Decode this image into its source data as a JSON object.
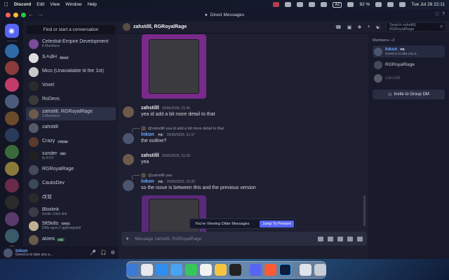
{
  "menubar": {
    "app": "Discord",
    "menus": [
      "Edit",
      "View",
      "Window",
      "Help"
    ],
    "input_source": "AZ",
    "battery": "92 %",
    "datetime": "Tue Jul 28  22:11"
  },
  "window": {
    "title": "Direct Messages"
  },
  "dm_list": {
    "search_label": "Find or start a conversation",
    "items": [
      {
        "name": "Celestial-Empire Development",
        "sub": "8 Members",
        "color": "#7a4a9c"
      },
      {
        "name": "ՏᗅᏰᎻ",
        "tag": "blend",
        "sub": "",
        "color": "#dddddd"
      },
      {
        "name": "Mico (Unavailable til the 1st)",
        "sub": "",
        "color": "#c9c9c9"
      },
      {
        "name": "Voxel",
        "sub": "",
        "color": "#2b2b2b"
      },
      {
        "name": "RoDevs",
        "sub": "",
        "color": "#3a3a3a"
      },
      {
        "name": "zahstilll, RGRoyalRage",
        "sub": "3 Members",
        "color": "#6d5a4a"
      },
      {
        "name": "zahstilll",
        "sub": "",
        "color": "#555a66"
      },
      {
        "name": "Crazy",
        "tag": "FRDM",
        "sub": "",
        "color": "#5a3a2c"
      },
      {
        "name": "sunder",
        "tag": "MD",
        "sub": "ily EVO",
        "color": "#202020"
      },
      {
        "name": "RGRoyalRage",
        "sub": "",
        "color": "#444a58"
      },
      {
        "name": "CaulisDev",
        "sub": "",
        "color": "#3a4a5a"
      },
      {
        "name": "改变",
        "sub": "",
        "color": "#2a2a2a"
      },
      {
        "name": "Bloxlink",
        "sub": "/invite | blox.link",
        "color": "#3a3c48"
      },
      {
        "name": "5ft5kills",
        "tag": "KRIG",
        "sub": "DMs open // gg/kriegsfall",
        "color": "#c0b090"
      },
      {
        "name": "aloeis",
        "tag": "HD",
        "sub": "",
        "color": "#6a5a4a"
      }
    ]
  },
  "user_panel": {
    "name": "lnkon",
    "status": "Greed is to take any a..."
  },
  "chat_header": {
    "title": "zahstilll, RGRoyalRage",
    "search_placeholder": "Search zahstilll, RGRoyalRage"
  },
  "messages": [
    {
      "author": "zahstilll",
      "time": "20/06/2026, 21:06",
      "text": "yea id add a bit more detail to that"
    },
    {
      "reply_to": "@zahstilll yea id add a bit more detail to that",
      "author": "lnkon",
      "tag": "PB",
      "time": "20/06/2026, 21:07",
      "text": "the outline?"
    },
    {
      "author": "zahstilll",
      "time": "20/06/2026, 21:09",
      "text": "yea"
    },
    {
      "reply_to": "@zahstilll yea",
      "author": "lnkon",
      "tag": "PB",
      "time": "20/06/2026, 23:20",
      "text": "so the issue is between this and the previous version"
    }
  ],
  "older_bar": {
    "text": "You're Viewing Older Messages",
    "button": "Jump To Present"
  },
  "composer": {
    "placeholder": "Message zahstilll, RGRoyalRage"
  },
  "members_panel": {
    "title": "Members—3",
    "members": [
      {
        "name": "lnkon",
        "tag": "PB",
        "status": "Greed is to take any a...",
        "color": "#4a5570"
      },
      {
        "name": "RGRoyalRage",
        "status": "",
        "color": "#444a58"
      },
      {
        "name": "zahstilll",
        "status": "",
        "color": "#555a66"
      }
    ],
    "invite_label": "Invite to Group DM"
  }
}
